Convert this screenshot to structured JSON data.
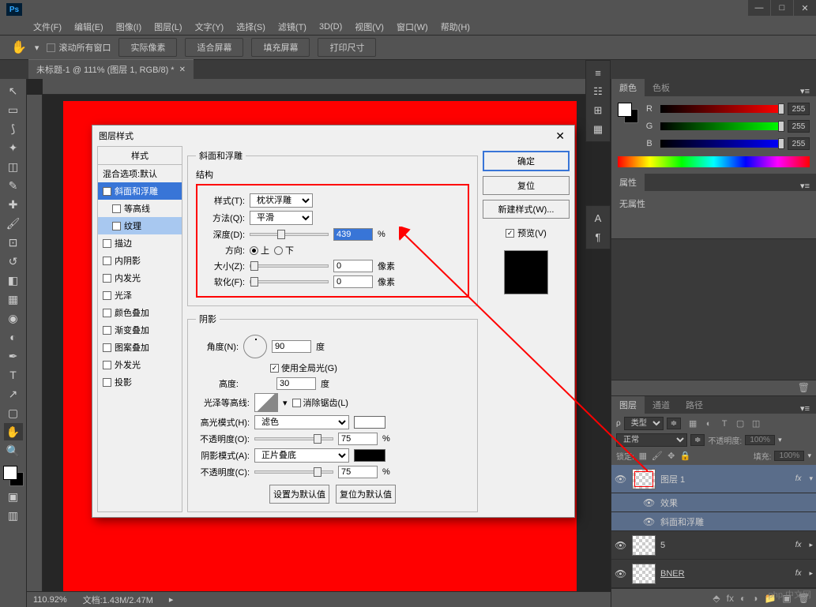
{
  "titlebar": {
    "app": "Ps"
  },
  "menu": [
    "文件(F)",
    "编辑(E)",
    "图像(I)",
    "图层(L)",
    "文字(Y)",
    "选择(S)",
    "滤镜(T)",
    "3D(D)",
    "视图(V)",
    "窗口(W)",
    "帮助(H)"
  ],
  "options": {
    "scroll_all": "滚动所有窗口",
    "actual_pixels": "实际像素",
    "fit_screen": "适合屏幕",
    "fill_screen": "填充屏幕",
    "print_size": "打印尺寸"
  },
  "doc_tab": "未标题-1 @ 111% (图层 1, RGB/8) *",
  "status": {
    "zoom": "110.92%",
    "doc": "文档:1.43M/2.47M"
  },
  "color_panel": {
    "tab_color": "颜色",
    "tab_swatches": "色板",
    "r": "R",
    "g": "G",
    "b": "B",
    "rv": "255",
    "gv": "255",
    "bv": "255"
  },
  "properties_panel": {
    "tab": "属性",
    "none": "无属性"
  },
  "layers_panel": {
    "tab_layers": "图层",
    "tab_channels": "通道",
    "tab_paths": "路径",
    "kind": "类型",
    "blend": "正常",
    "opacity_label": "不透明度:",
    "opacity": "100%",
    "lock_label": "锁定:",
    "fill_label": "填充:",
    "fill": "100%",
    "layers": [
      {
        "name": "图层 1",
        "fx": "fx",
        "selected": true
      },
      {
        "name": "效果",
        "sub": true
      },
      {
        "name": "斜面和浮雕",
        "sub": true
      },
      {
        "name": "5",
        "fx": "fx"
      },
      {
        "name": "BNER",
        "fx": "fx"
      }
    ]
  },
  "dialog": {
    "title": "图层样式",
    "styles_header": "样式",
    "blend_header": "混合选项:默认",
    "list": [
      {
        "label": "斜面和浮雕",
        "checked": true,
        "selected": true
      },
      {
        "label": "等高线",
        "sub": true
      },
      {
        "label": "纹理",
        "sub": true,
        "highlighted": true
      },
      {
        "label": "描边"
      },
      {
        "label": "内阴影"
      },
      {
        "label": "内发光"
      },
      {
        "label": "光泽"
      },
      {
        "label": "颜色叠加"
      },
      {
        "label": "渐变叠加"
      },
      {
        "label": "图案叠加"
      },
      {
        "label": "外发光"
      },
      {
        "label": "投影"
      }
    ],
    "group_structure": "斜面和浮雕",
    "group_structure_sub": "结构",
    "style_label": "样式(T):",
    "style_value": "枕状浮雕",
    "technique_label": "方法(Q):",
    "technique_value": "平滑",
    "depth_label": "深度(D):",
    "depth_value": "439",
    "depth_unit": "%",
    "direction_label": "方向:",
    "direction_up": "上",
    "direction_down": "下",
    "size_label": "大小(Z):",
    "size_value": "0",
    "size_unit": "像素",
    "soften_label": "软化(F):",
    "soften_value": "0",
    "soften_unit": "像素",
    "group_shading": "阴影",
    "angle_label": "角度(N):",
    "angle_value": "90",
    "angle_unit": "度",
    "global_light": "使用全局光(G)",
    "altitude_label": "高度:",
    "altitude_value": "30",
    "altitude_unit": "度",
    "gloss_label": "光泽等高线:",
    "antialias": "消除锯齿(L)",
    "highlight_mode_label": "高光模式(H):",
    "highlight_mode": "滤色",
    "highlight_opacity_label": "不透明度(O):",
    "highlight_opacity": "75",
    "pct": "%",
    "shadow_mode_label": "阴影模式(A):",
    "shadow_mode": "正片叠底",
    "shadow_opacity_label": "不透明度(C):",
    "shadow_opacity": "75",
    "set_default": "设置为默认值",
    "reset_default": "复位为默认值",
    "ok": "确定",
    "cancel": "复位",
    "new_style": "新建样式(W)...",
    "preview": "预览(V)"
  },
  "watermark": "php 中文网"
}
